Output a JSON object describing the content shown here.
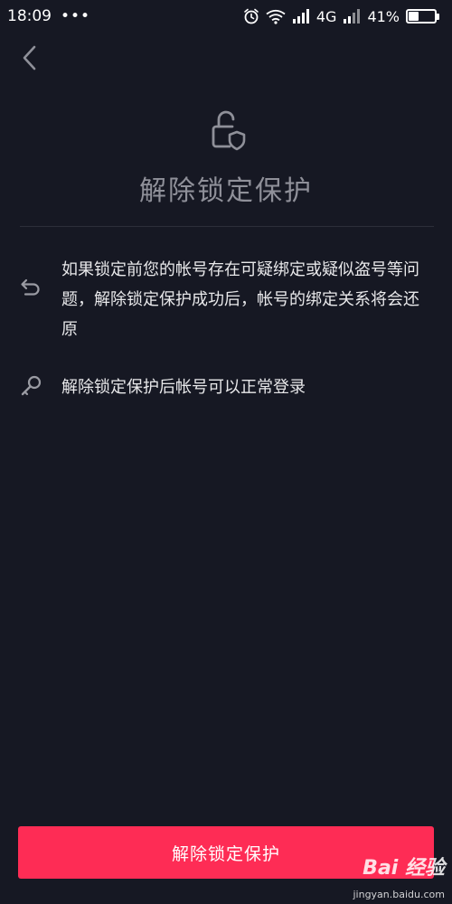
{
  "status_bar": {
    "time": "18:09",
    "dots": "•••",
    "network": "4G",
    "battery_percent": "41%",
    "battery_level": 0.41
  },
  "header": {
    "title": "解除锁定保护"
  },
  "info_items": [
    {
      "icon": "undo-arrow-icon",
      "text": "如果锁定前您的帐号存在可疑绑定或疑似盗号等问题，解除锁定保护成功后，帐号的绑定关系将会还原"
    },
    {
      "icon": "key-icon",
      "text": "解除锁定保护后帐号可以正常登录"
    }
  ],
  "action_button": {
    "label": "解除锁定保护"
  },
  "watermark": {
    "logo_text": "Bai 经验",
    "url": "jingyan.baidu.com"
  },
  "colors": {
    "background": "#161823",
    "accent": "#fe2c55",
    "title_gray": "#8f9099"
  }
}
